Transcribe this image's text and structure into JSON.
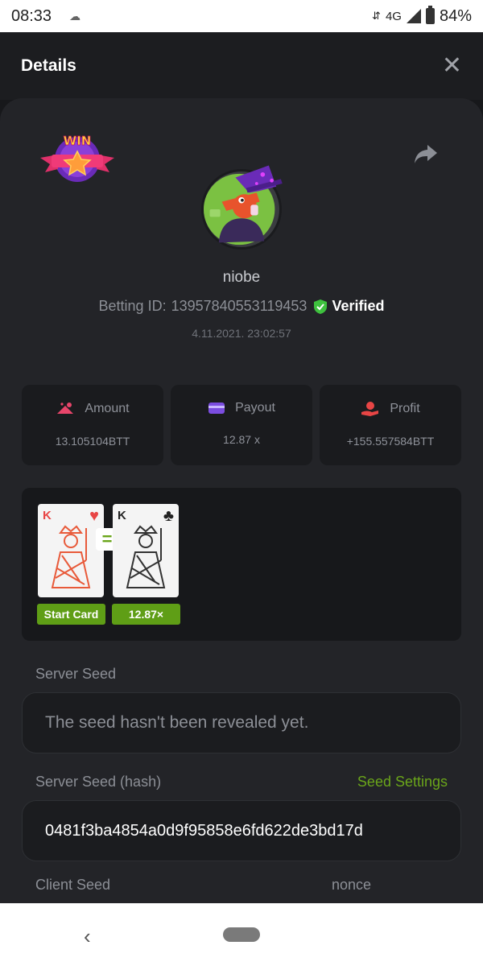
{
  "status_bar": {
    "time": "08:33",
    "network": "4G",
    "battery": "84%"
  },
  "header": {
    "title": "Details"
  },
  "bet": {
    "badge_text": "WIN",
    "username": "niobe",
    "betting_id_label": "Betting ID:",
    "betting_id": "13957840553119453",
    "verified_label": "Verified",
    "date": "4.11.2021. 23:02:57"
  },
  "stats": [
    {
      "label": "Amount",
      "value": "13.105104BTT",
      "icon": "coins-icon",
      "color": "#e8456a"
    },
    {
      "label": "Payout",
      "value": "12.87 x",
      "icon": "wallet-card-icon",
      "color": "#7b4de0"
    },
    {
      "label": "Profit",
      "value": "+155.557584BTT",
      "icon": "hand-profit-icon",
      "color": "#e84545"
    }
  ],
  "game": {
    "start_card": {
      "rank": "K",
      "suit": "♥",
      "tag": "Start Card"
    },
    "result_card": {
      "rank": "K",
      "suit": "♣",
      "tag": "12.87×"
    },
    "equals": "="
  },
  "seeds": {
    "server_seed_label": "Server Seed",
    "server_seed_value": "The seed hasn't been revealed yet.",
    "server_seed_hash_label": "Server Seed (hash)",
    "seed_settings_link": "Seed Settings",
    "server_seed_hash_value": "0481f3ba4854a0d9f95858e6fd622de3bd17d",
    "client_seed_label": "Client Seed",
    "nonce_label": "nonce"
  },
  "colors": {
    "accent_green": "#5f9e16",
    "link_green": "#6aa51a",
    "verified_green": "#3ec13e"
  }
}
